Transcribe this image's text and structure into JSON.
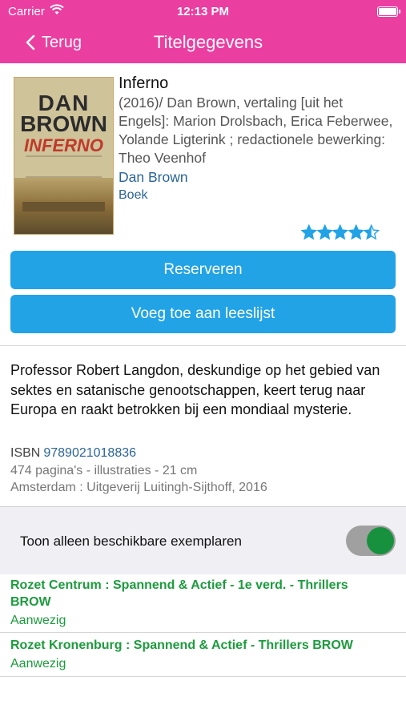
{
  "status_bar": {
    "carrier": "Carrier",
    "time": "12:13 PM"
  },
  "nav": {
    "back_label": "Terug",
    "title": "Titelgegevens"
  },
  "book": {
    "cover_text": {
      "line1": "DAN",
      "line2": "BROWN",
      "line3": "INFERNO"
    },
    "title": "Inferno",
    "description": "(2016)/ Dan Brown, vertaling [uit het Engels]: Marion Drolsbach, Erica Feberwee, Yolande Ligterink ; redactionele bewerking: Theo Veenhof",
    "author": "Dan Brown",
    "type": "Boek",
    "rating": 4.5,
    "rating_max": 5
  },
  "actions": {
    "reserve": "Reserveren",
    "add_list": "Voeg toe aan leeslijst"
  },
  "summary": "Professor Robert Langdon, deskundige op het gebied van sektes en satanische genootschappen, keert terug naar Europa en raakt betrokken bij een mondiaal mysterie.",
  "details": {
    "isbn_label": "ISBN",
    "isbn": "9789021018836",
    "pages": "474 pagina's - illustraties - 21 cm",
    "publisher": "Amsterdam : Uitgeverij Luitingh-Sijthoff, 2016"
  },
  "availability": {
    "toggle_label": "Toon alleen beschikbare exemplaren",
    "toggle_on": true,
    "locations": [
      {
        "name": "Rozet Centrum : Spannend & Actief - 1e verd. - Thrillers BROW",
        "status": "Aanwezig"
      },
      {
        "name": "Rozet Kronenburg : Spannend & Actief - Thrillers BROW",
        "status": "Aanwezig"
      }
    ]
  },
  "colors": {
    "brand": "#ea3ea0",
    "button": "#21a3e6",
    "link": "#2a6496",
    "available": "#1d9b3e",
    "toggle_knob": "#17913d"
  }
}
